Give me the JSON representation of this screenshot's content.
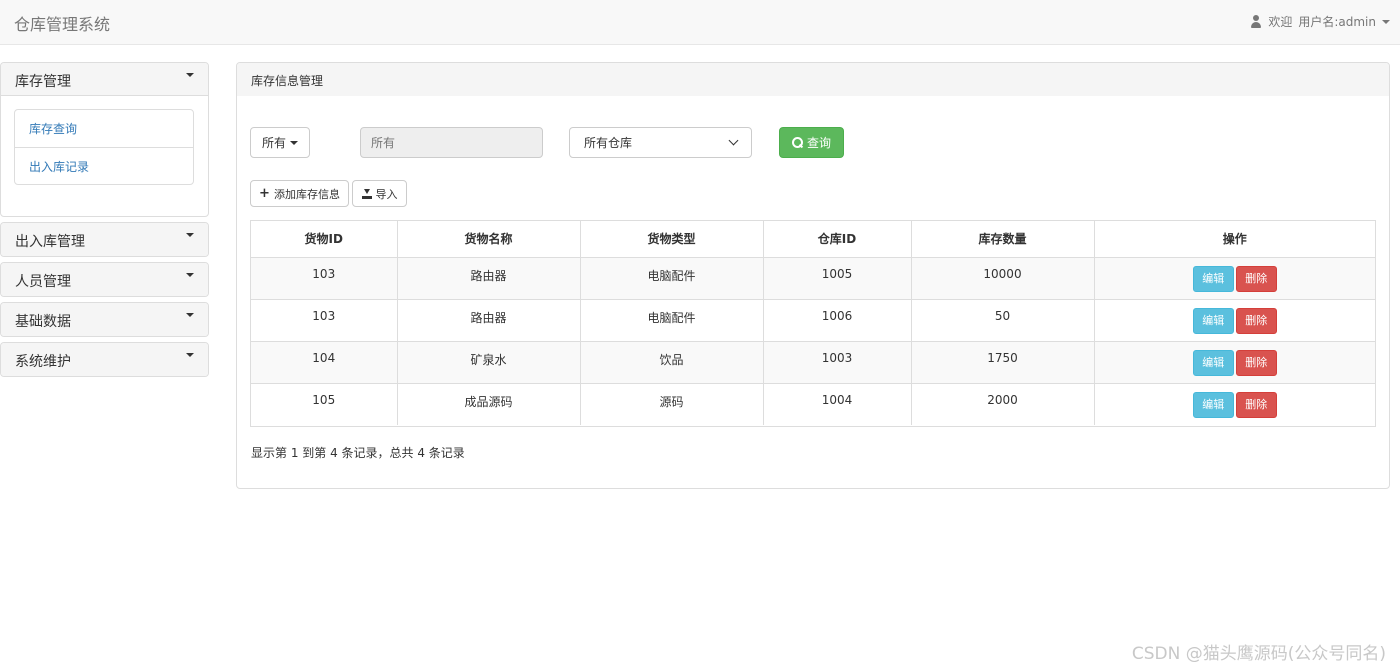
{
  "navbar": {
    "brand": "仓库管理系统",
    "welcome": "欢迎",
    "username": "用户名:admin"
  },
  "sidebar": {
    "groups": [
      {
        "label": "库存管理",
        "items": [
          "库存查询",
          "出入库记录"
        ]
      },
      {
        "label": "出入库管理"
      },
      {
        "label": "人员管理"
      },
      {
        "label": "基础数据"
      },
      {
        "label": "系统维护"
      }
    ]
  },
  "main": {
    "title": "库存信息管理",
    "filter": {
      "type_label": "所有",
      "input_placeholder": "所有",
      "warehouse_selected": "所有仓库",
      "query_label": "查询"
    },
    "toolbar": {
      "add_label": "添加库存信息",
      "import_label": "导入"
    },
    "table": {
      "columns": [
        "货物ID",
        "货物名称",
        "货物类型",
        "仓库ID",
        "库存数量",
        "操作"
      ],
      "rows": [
        [
          "103",
          "路由器",
          "电脑配件",
          "1005",
          "10000"
        ],
        [
          "103",
          "路由器",
          "电脑配件",
          "1006",
          "50"
        ],
        [
          "104",
          "矿泉水",
          "饮品",
          "1003",
          "1750"
        ],
        [
          "105",
          "成品源码",
          "源码",
          "1004",
          "2000"
        ]
      ],
      "edit_label": "编辑",
      "delete_label": "删除"
    },
    "pagination_info": "显示第 1 到第 4 条记录，总共 4 条记录"
  },
  "watermark": "CSDN @猫头鹰源码(公众号同名)"
}
